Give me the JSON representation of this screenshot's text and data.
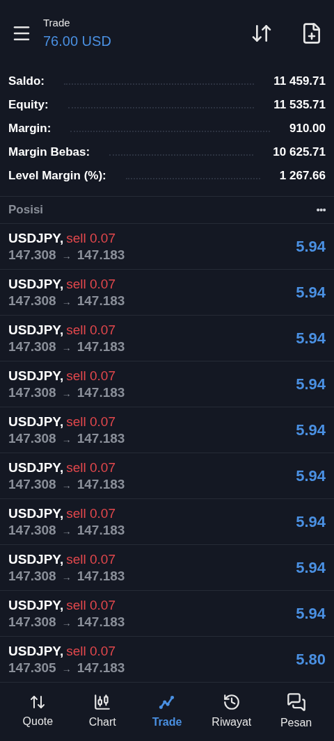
{
  "header": {
    "title": "Trade",
    "subtitle": "76.00 USD"
  },
  "summary": [
    {
      "label": "Saldo:",
      "value": "11 459.71"
    },
    {
      "label": "Equity:",
      "value": "11 535.71"
    },
    {
      "label": "Margin:",
      "value": "910.00"
    },
    {
      "label": "Margin Bebas:",
      "value": "10 625.71"
    },
    {
      "label": "Level Margin (%):",
      "value": "1 267.66"
    }
  ],
  "positions_header": {
    "title": "Posisi",
    "menu": "•••"
  },
  "positions": [
    {
      "symbol": "USDJPY,",
      "side": "sell",
      "volume": "0.07",
      "open": "147.308",
      "arrow": "→",
      "current": "147.183",
      "profit": "5.94"
    },
    {
      "symbol": "USDJPY,",
      "side": "sell",
      "volume": "0.07",
      "open": "147.308",
      "arrow": "→",
      "current": "147.183",
      "profit": "5.94"
    },
    {
      "symbol": "USDJPY,",
      "side": "sell",
      "volume": "0.07",
      "open": "147.308",
      "arrow": "→",
      "current": "147.183",
      "profit": "5.94"
    },
    {
      "symbol": "USDJPY,",
      "side": "sell",
      "volume": "0.07",
      "open": "147.308",
      "arrow": "→",
      "current": "147.183",
      "profit": "5.94"
    },
    {
      "symbol": "USDJPY,",
      "side": "sell",
      "volume": "0.07",
      "open": "147.308",
      "arrow": "→",
      "current": "147.183",
      "profit": "5.94"
    },
    {
      "symbol": "USDJPY,",
      "side": "sell",
      "volume": "0.07",
      "open": "147.308",
      "arrow": "→",
      "current": "147.183",
      "profit": "5.94"
    },
    {
      "symbol": "USDJPY,",
      "side": "sell",
      "volume": "0.07",
      "open": "147.308",
      "arrow": "→",
      "current": "147.183",
      "profit": "5.94"
    },
    {
      "symbol": "USDJPY,",
      "side": "sell",
      "volume": "0.07",
      "open": "147.308",
      "arrow": "→",
      "current": "147.183",
      "profit": "5.94"
    },
    {
      "symbol": "USDJPY,",
      "side": "sell",
      "volume": "0.07",
      "open": "147.308",
      "arrow": "→",
      "current": "147.183",
      "profit": "5.94"
    },
    {
      "symbol": "USDJPY,",
      "side": "sell",
      "volume": "0.07",
      "open": "147.305",
      "arrow": "→",
      "current": "147.183",
      "profit": "5.80"
    }
  ],
  "nav": [
    {
      "kind": "quote",
      "label": "Quote",
      "selected": false
    },
    {
      "kind": "chart",
      "label": "Chart",
      "selected": false
    },
    {
      "kind": "trade",
      "label": "Trade",
      "selected": true
    },
    {
      "kind": "history",
      "label": "Riwayat",
      "selected": false
    },
    {
      "kind": "messages",
      "label": "Pesan",
      "selected": false
    }
  ]
}
